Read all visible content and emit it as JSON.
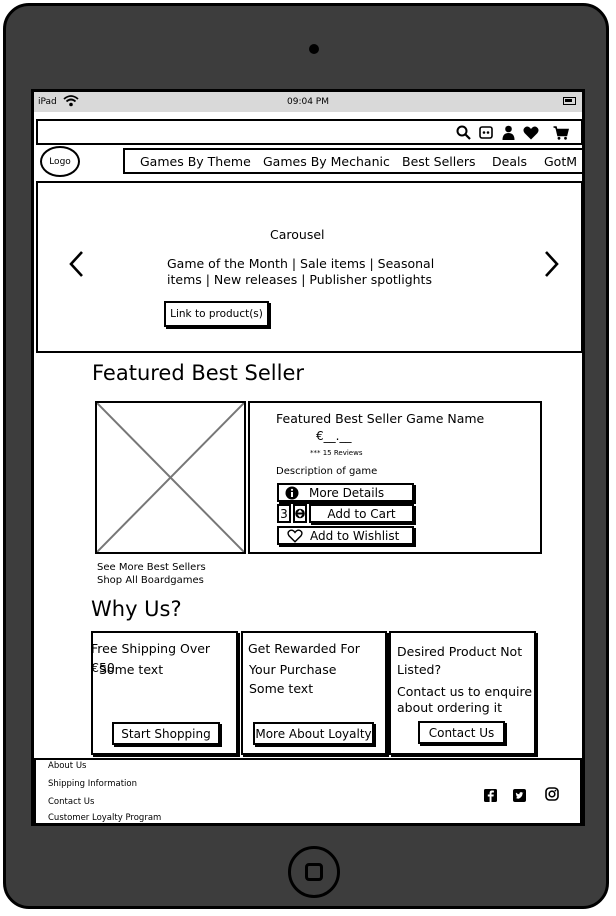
{
  "status_bar": {
    "device": "iPad",
    "time": "09:04 PM"
  },
  "header": {
    "icons": [
      "search-icon",
      "game-icon",
      "user-icon",
      "heart-icon",
      "cart-icon"
    ]
  },
  "nav": {
    "logo": "Logo",
    "items": [
      "Games By Theme",
      "Games By Mechanic",
      "Best Sellers",
      "Deals",
      "GotM"
    ]
  },
  "carousel": {
    "title": "Carousel",
    "text_line1": "Game of the Month | Sale items | Seasonal",
    "text_line2": "items | New releases | Publisher spotlights",
    "button": "Link to product(s)"
  },
  "featured": {
    "heading": "Featured Best Seller",
    "product_name": "Featured Best Seller Game Name",
    "price": "€__.__",
    "reviews": "*** 15 Reviews",
    "description": "Description of game",
    "more_details": "More Details",
    "quantity": "3",
    "add_to_cart": "Add to Cart",
    "add_to_wishlist": "Add to Wishlist",
    "link_more": "See More Best Sellers",
    "link_all": "Shop All Boardgames"
  },
  "why": {
    "heading": "Why Us?",
    "cards": [
      {
        "title": "Free Shipping Over €50",
        "body": "Some text",
        "button": "Start Shopping"
      },
      {
        "title_line1": "Get Rewarded For",
        "title_line2": "Your Purchase",
        "body": "Some text",
        "button": "More About Loyalty"
      },
      {
        "title_line1": "Desired Product Not",
        "title_line2": "Listed?",
        "body_line1": "Contact us to enquire",
        "body_line2": "about ordering it",
        "button": "Contact Us"
      }
    ]
  },
  "footer": {
    "links": [
      "About Us",
      "Shipping Information",
      "Contact Us",
      "Customer Loyalty Program"
    ],
    "social": [
      "facebook-icon",
      "twitter-icon",
      "instagram-icon"
    ]
  }
}
